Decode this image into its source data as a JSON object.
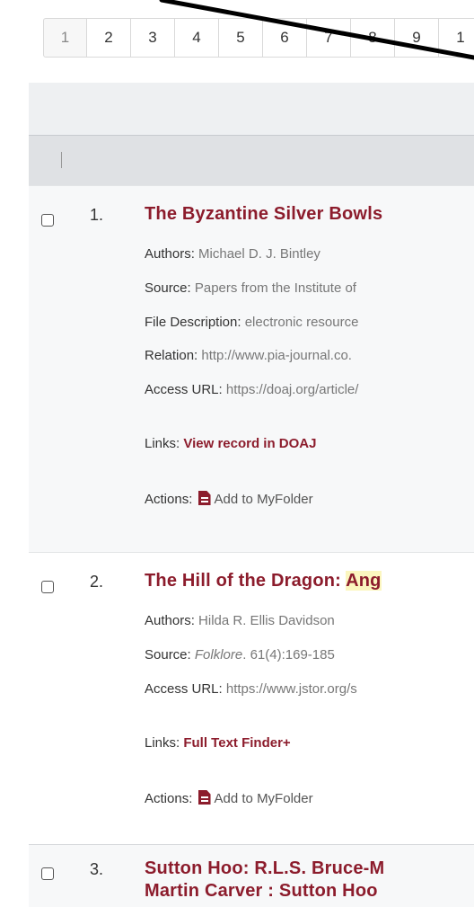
{
  "pagination": {
    "pages": [
      "1",
      "2",
      "3",
      "4",
      "5",
      "6",
      "7",
      "8",
      "9",
      "1"
    ]
  },
  "results": [
    {
      "number": "1.",
      "title": "The Byzantine Silver Bowls",
      "fields": [
        {
          "label": "Authors:",
          "value": " Michael D. J. Bintley"
        },
        {
          "label": "Source:",
          "value": " Papers from the Institute of"
        },
        {
          "label": "File Description:",
          "value": " electronic resource"
        },
        {
          "label": "Relation:",
          "value": " http://www.pia-journal.co."
        },
        {
          "label": "Access URL:",
          "value": " https://doaj.org/article/"
        }
      ],
      "links_label": "Links:",
      "links_value": "View record in DOAJ",
      "actions_label": "Actions:",
      "actions_value": "Add to MyFolder"
    },
    {
      "number": "2.",
      "title_plain": "The Hill of the Dragon: ",
      "title_hl": "Ang",
      "authors_label": "Authors:",
      "authors_value": " Hilda R. Ellis Davidson",
      "source_label": "Source:",
      "source_journal": "Folklore",
      "source_rest": ". 61(4):169-185",
      "access_label": "Access URL:",
      "access_value": " https://www.jstor.org/s",
      "links_label": "Links:",
      "links_value": "Full Text Finder+",
      "actions_label": "Actions:",
      "actions_value": "Add to MyFolder"
    },
    {
      "number": "3.",
      "title_line1": "Sutton Hoo: R.L.S. Bruce-M",
      "title_line2": "Martin Carver : Sutton Hoo"
    }
  ]
}
